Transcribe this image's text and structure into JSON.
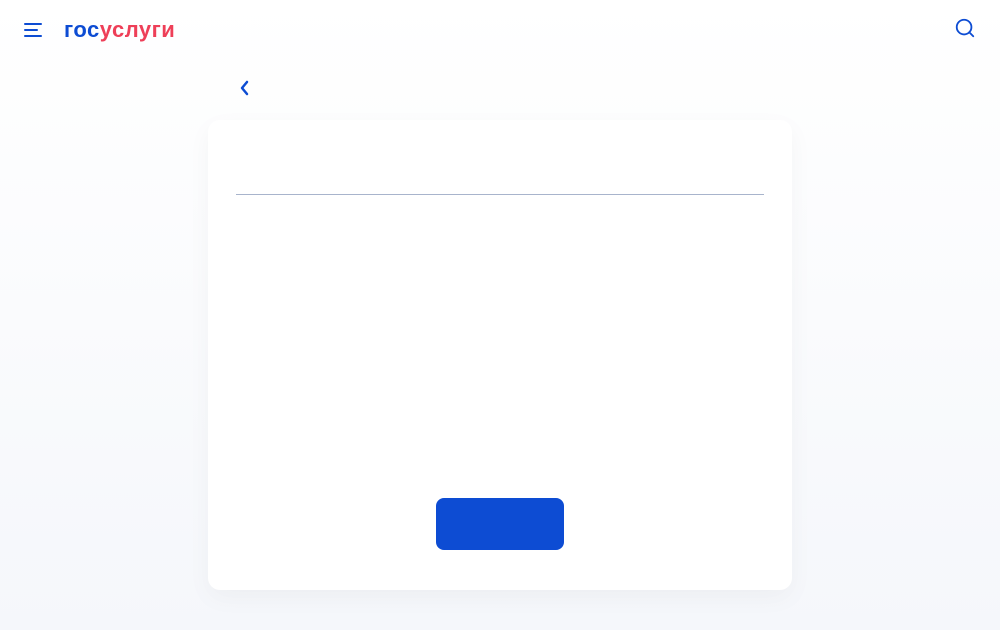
{
  "header": {
    "logo_part1": "гос",
    "logo_part2": "услуги"
  },
  "card": {
    "submit_label": ""
  }
}
